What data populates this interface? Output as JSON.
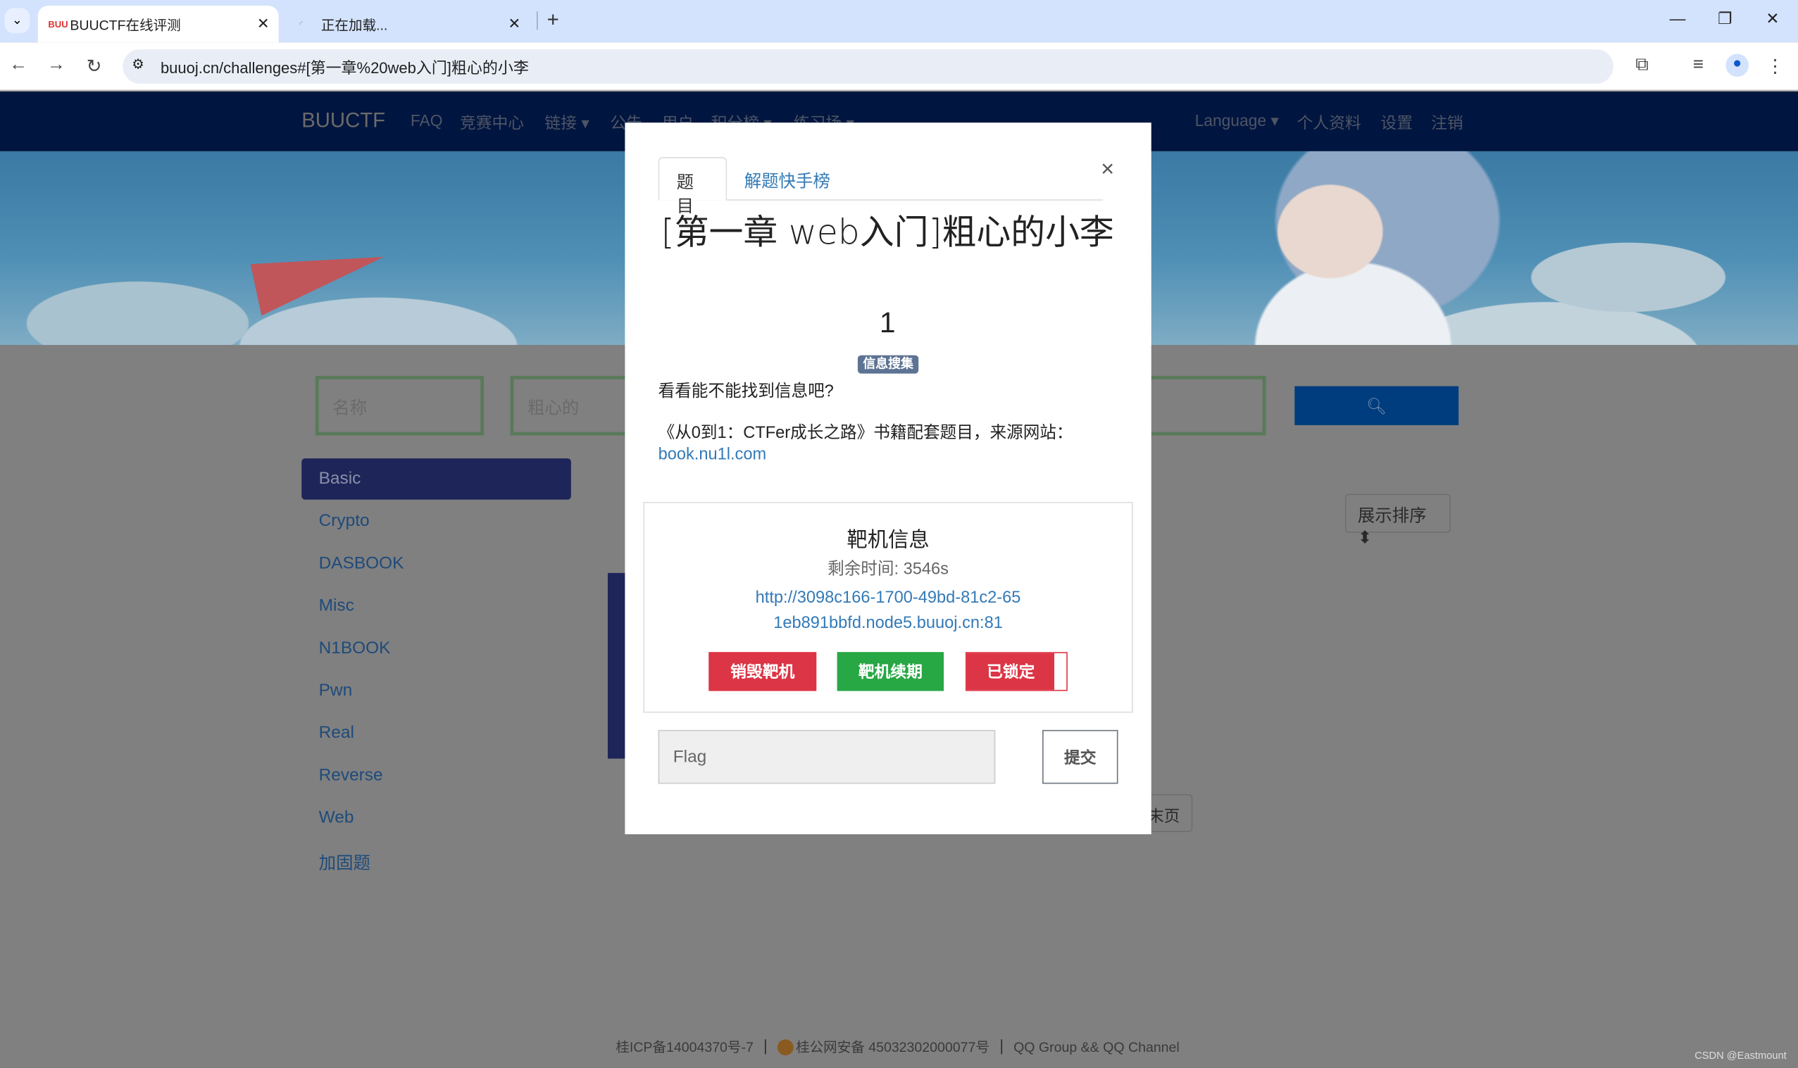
{
  "browser": {
    "tabs": [
      {
        "title": "BUUCTF在线评测",
        "favicon": "BUU",
        "active": true
      },
      {
        "title": "正在加载...",
        "active": false
      }
    ],
    "new_tab": "+",
    "url": "buuoj.cn/challenges#[第一章%20web入门]粗心的小李"
  },
  "navbar": {
    "brand": "BUUCTF",
    "left_items": [
      "FAQ",
      "竞赛中心",
      "链接 ▾",
      "公告",
      "用户",
      "积分榜 ▾",
      "练习场 ▾"
    ],
    "right_items": [
      "Language ▾",
      "个人资料",
      "设置",
      "注销"
    ]
  },
  "search": {
    "name_placeholder": "名称",
    "keyword_value": "粗心的",
    "button_icon": "search-icon"
  },
  "sidebar": {
    "items": [
      "Basic",
      "Crypto",
      "DASBOOK",
      "Misc",
      "N1BOOK",
      "Pwn",
      "Real",
      "Reverse",
      "Web",
      "加固题"
    ],
    "active": "Basic"
  },
  "sort_button": "展示排序 ⬍",
  "pagination": {
    "last": "末页"
  },
  "footer": {
    "icp": "桂ICP备14004370号-7",
    "police": "桂公网安备 45032302000077号",
    "qq": "QQ Group && QQ Channel",
    "watermark": "CSDN @Eastmount"
  },
  "modal": {
    "tabs": [
      "题目",
      "解题快手榜"
    ],
    "close": "×",
    "title": "[第一章 web入门]粗心的小李",
    "value": "1",
    "tag": "信息搜集",
    "description": "看看能不能找到信息吧?",
    "source": "《从0到1：CTFer成长之路》书籍配套题目，来源网站：",
    "source_link": "book.nu1l.com",
    "instance": {
      "heading": "靶机信息",
      "remaining": "剩余时间: 3546s",
      "url": "http://3098c166-1700-49bd-81c2-651eb891bbfd.node5.buuoj.cn:81",
      "destroy": "销毁靶机",
      "renew": "靶机续期",
      "locked": "已锁定"
    },
    "flag_placeholder": "Flag",
    "submit": "提交"
  },
  "colors": {
    "navbar": "#00153f",
    "danger": "#dc3545",
    "success": "#28a745",
    "link": "#337ab7",
    "sidebar_active": "#1e2559"
  }
}
